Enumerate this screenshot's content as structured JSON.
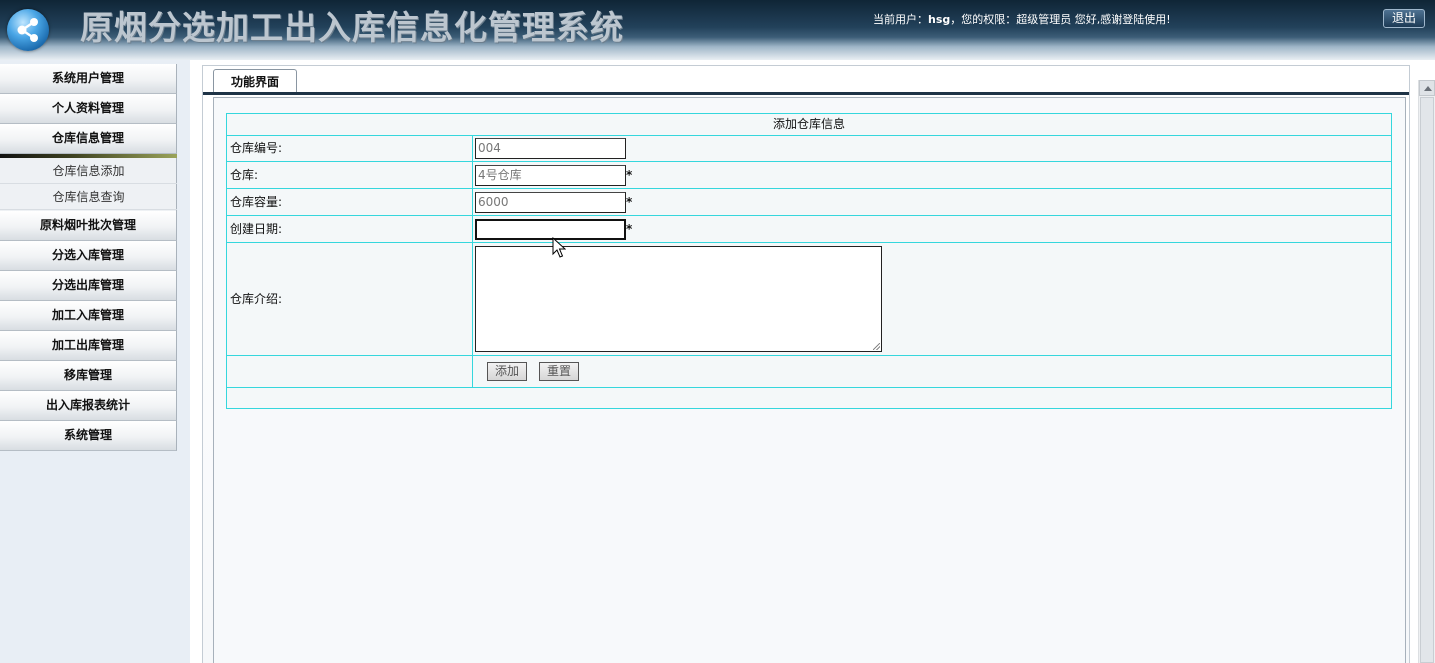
{
  "header": {
    "app_title": "原烟分选加工出入库信息化管理系统",
    "user_prefix": "当前用户：",
    "username": "hsg",
    "role_prefix": "，您的权限：",
    "role": "超级管理员",
    "greeting": " 您好,感谢登陆使用!",
    "logout_label": "退出"
  },
  "sidebar": {
    "items": [
      {
        "label": "系统用户管理"
      },
      {
        "label": "个人资料管理"
      },
      {
        "label": "仓库信息管理"
      },
      {
        "label": "原料烟叶批次管理"
      },
      {
        "label": "分选入库管理"
      },
      {
        "label": "分选出库管理"
      },
      {
        "label": "加工入库管理"
      },
      {
        "label": "加工出库管理"
      },
      {
        "label": "移库管理"
      },
      {
        "label": "出入库报表统计"
      },
      {
        "label": "系统管理"
      }
    ],
    "submenu": [
      {
        "label": "仓库信息添加"
      },
      {
        "label": "仓库信息查询"
      }
    ]
  },
  "tab": {
    "label": "功能界面"
  },
  "form": {
    "title": "添加仓库信息",
    "fields": [
      {
        "label": "仓库编号:",
        "value": "004"
      },
      {
        "label": "仓库:",
        "value": "4号仓库",
        "required": "*"
      },
      {
        "label": "仓库容量:",
        "value": "6000",
        "required": "*"
      },
      {
        "label": "创建日期:",
        "value": "",
        "required": "*"
      }
    ],
    "intro_label": "仓库介绍:",
    "intro_value": "",
    "submit_label": "添加",
    "reset_label": "重置"
  }
}
